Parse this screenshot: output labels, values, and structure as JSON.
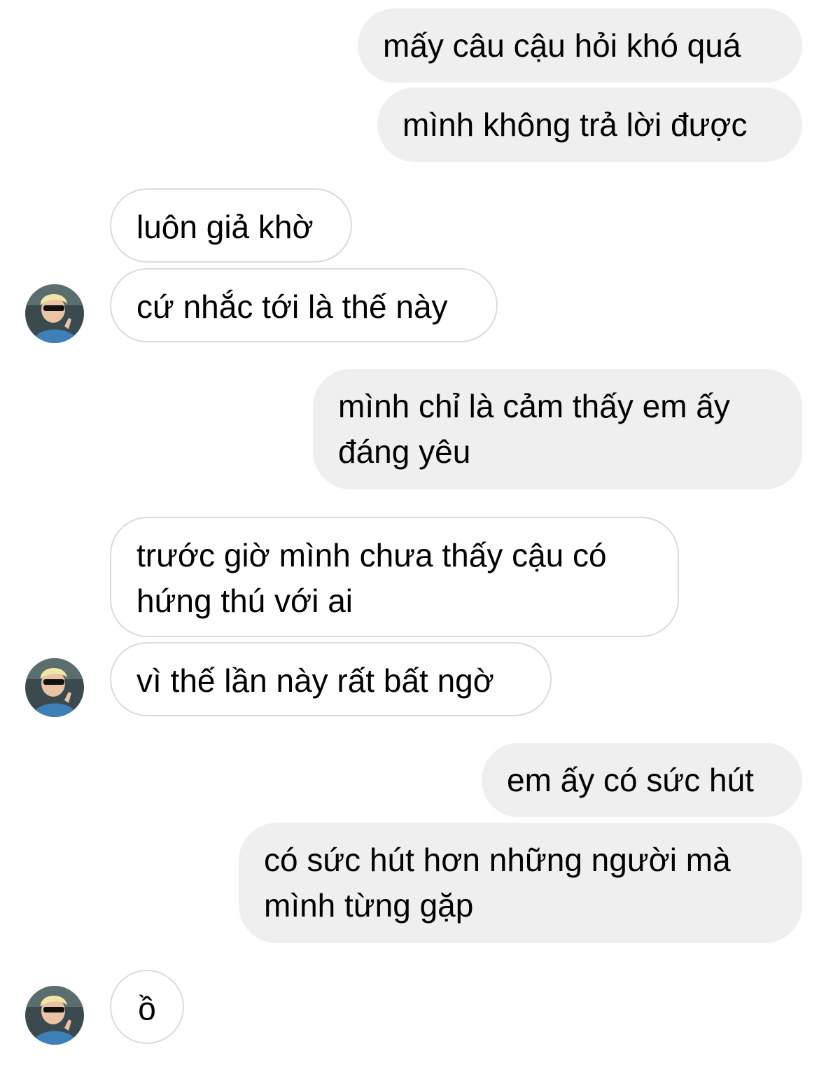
{
  "colors": {
    "outgoing_bubble": "#efefef",
    "incoming_bubble": "#ffffff",
    "incoming_border": "#dbdbdb",
    "text": "#000000"
  },
  "avatar": {
    "icon": "contact-avatar-photo"
  },
  "messages": [
    {
      "id": "m1",
      "side": "outgoing",
      "text": "mấy câu cậu hỏi khó quá"
    },
    {
      "id": "m2",
      "side": "outgoing",
      "text": "mình không trả lời được"
    },
    {
      "id": "m3",
      "side": "incoming",
      "text": "luôn giả khờ"
    },
    {
      "id": "m4",
      "side": "incoming",
      "text": "cứ nhắc tới là thế này"
    },
    {
      "id": "m5",
      "side": "outgoing",
      "lines": [
        "mình chỉ là cảm thấy em ấy",
        "đáng yêu"
      ]
    },
    {
      "id": "m6",
      "side": "incoming",
      "lines": [
        "trước giờ mình chưa thấy cậu có",
        "hứng thú với ai"
      ]
    },
    {
      "id": "m7",
      "side": "incoming",
      "text": "vì thế lần này rất bất ngờ"
    },
    {
      "id": "m8",
      "side": "outgoing",
      "text": "em ấy có sức hút"
    },
    {
      "id": "m9",
      "side": "outgoing",
      "lines": [
        "có sức hút hơn những người mà",
        "mình từng gặp"
      ]
    },
    {
      "id": "m10",
      "side": "incoming",
      "text": "ồ"
    }
  ]
}
